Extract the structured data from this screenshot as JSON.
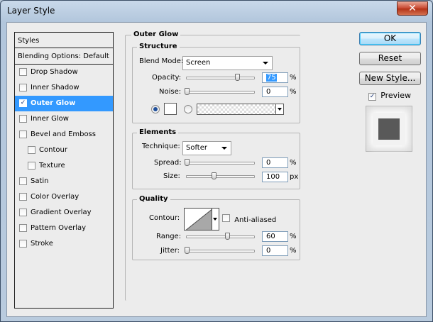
{
  "window": {
    "title": "Layer Style",
    "close_glyph": "✕"
  },
  "styles_list": {
    "header": "Styles",
    "blending": "Blending Options: Default",
    "items": [
      {
        "label": "Drop Shadow",
        "checked": false,
        "sub": false,
        "selected": false
      },
      {
        "label": "Inner Shadow",
        "checked": false,
        "sub": false,
        "selected": false
      },
      {
        "label": "Outer Glow",
        "checked": true,
        "sub": false,
        "selected": true
      },
      {
        "label": "Inner Glow",
        "checked": false,
        "sub": false,
        "selected": false
      },
      {
        "label": "Bevel and Emboss",
        "checked": false,
        "sub": false,
        "selected": false
      },
      {
        "label": "Contour",
        "checked": false,
        "sub": true,
        "selected": false
      },
      {
        "label": "Texture",
        "checked": false,
        "sub": true,
        "selected": false
      },
      {
        "label": "Satin",
        "checked": false,
        "sub": false,
        "selected": false
      },
      {
        "label": "Color Overlay",
        "checked": false,
        "sub": false,
        "selected": false
      },
      {
        "label": "Gradient Overlay",
        "checked": false,
        "sub": false,
        "selected": false
      },
      {
        "label": "Pattern Overlay",
        "checked": false,
        "sub": false,
        "selected": false
      },
      {
        "label": "Stroke",
        "checked": false,
        "sub": false,
        "selected": false
      }
    ]
  },
  "outer_glow": {
    "title": "Outer Glow",
    "structure": {
      "label": "Structure",
      "blend_mode_label": "Blend Mode:",
      "blend_mode_value": "Screen",
      "opacity_label": "Opacity:",
      "opacity_value": "75",
      "opacity_unit": "%",
      "opacity_level": 0.75,
      "noise_label": "Noise:",
      "noise_value": "0",
      "noise_unit": "%",
      "noise_level": 0,
      "glow_color": "#ffffff",
      "color_radio_selected": true
    },
    "elements": {
      "label": "Elements",
      "technique_label": "Technique:",
      "technique_value": "Softer",
      "spread_label": "Spread:",
      "spread_value": "0",
      "spread_unit": "%",
      "spread_level": 0,
      "size_label": "Size:",
      "size_value": "100",
      "size_unit": "px",
      "size_level": 0.4
    },
    "quality": {
      "label": "Quality",
      "contour_label": "Contour:",
      "anti_aliased_label": "Anti-aliased",
      "anti_aliased_checked": false,
      "range_label": "Range:",
      "range_value": "60",
      "range_unit": "%",
      "range_level": 0.6,
      "jitter_label": "Jitter:",
      "jitter_value": "0",
      "jitter_unit": "%",
      "jitter_level": 0
    }
  },
  "buttons": {
    "ok": "OK",
    "reset": "Reset",
    "new_style": "New Style..."
  },
  "preview": {
    "label": "Preview",
    "checked": true
  }
}
